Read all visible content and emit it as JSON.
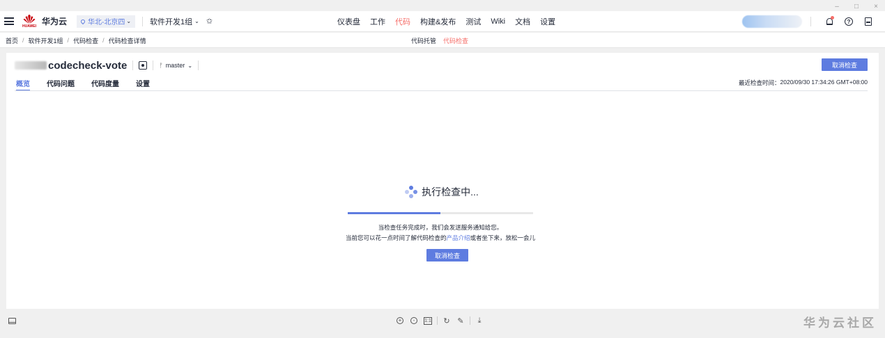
{
  "window": {
    "minimize": "–",
    "maximize": "□",
    "close": "×"
  },
  "topbar": {
    "logo_sub": "HUAWEI",
    "brand": "华为云",
    "region": "华北-北京四",
    "project": "软件开发1组",
    "nav": [
      "仪表盘",
      "工作",
      "代码",
      "构建&发布",
      "测试",
      "Wiki",
      "文档",
      "设置"
    ],
    "active_nav": "代码"
  },
  "breadcrumb": {
    "items": [
      "首页",
      "软件开发1组",
      "代码检查",
      "代码检查详情"
    ],
    "separator": "/"
  },
  "subnav": {
    "items": [
      "代码托管",
      "代码检查"
    ],
    "active": "代码检查"
  },
  "repo": {
    "name": "codecheck-vote",
    "branch": "master",
    "cancel_button": "取消检查",
    "tabs": [
      "概览",
      "代码问题",
      "代码度量",
      "设置"
    ],
    "last_check_label": "最近检查时间：",
    "last_check_value": "2020/09/30 17:34:26 GMT+08:00"
  },
  "running": {
    "title": "执行检查中...",
    "progress": 0.5,
    "msg1": "当检查任务完成时，我们会发送服务通知给您。",
    "msg2_prefix": "当前您可以花一点时间了解代码检查的",
    "msg2_link": "产品介绍",
    "msg2_suffix": "或者坐下来，放松一会儿",
    "cancel_button": "取消检查"
  },
  "bottombar": {
    "fit_label": "1:1",
    "watermark": "华为云社区"
  },
  "colors": {
    "accent": "#5e7ce0",
    "active_red": "#f66f6a",
    "brand_red": "#c7000b"
  }
}
